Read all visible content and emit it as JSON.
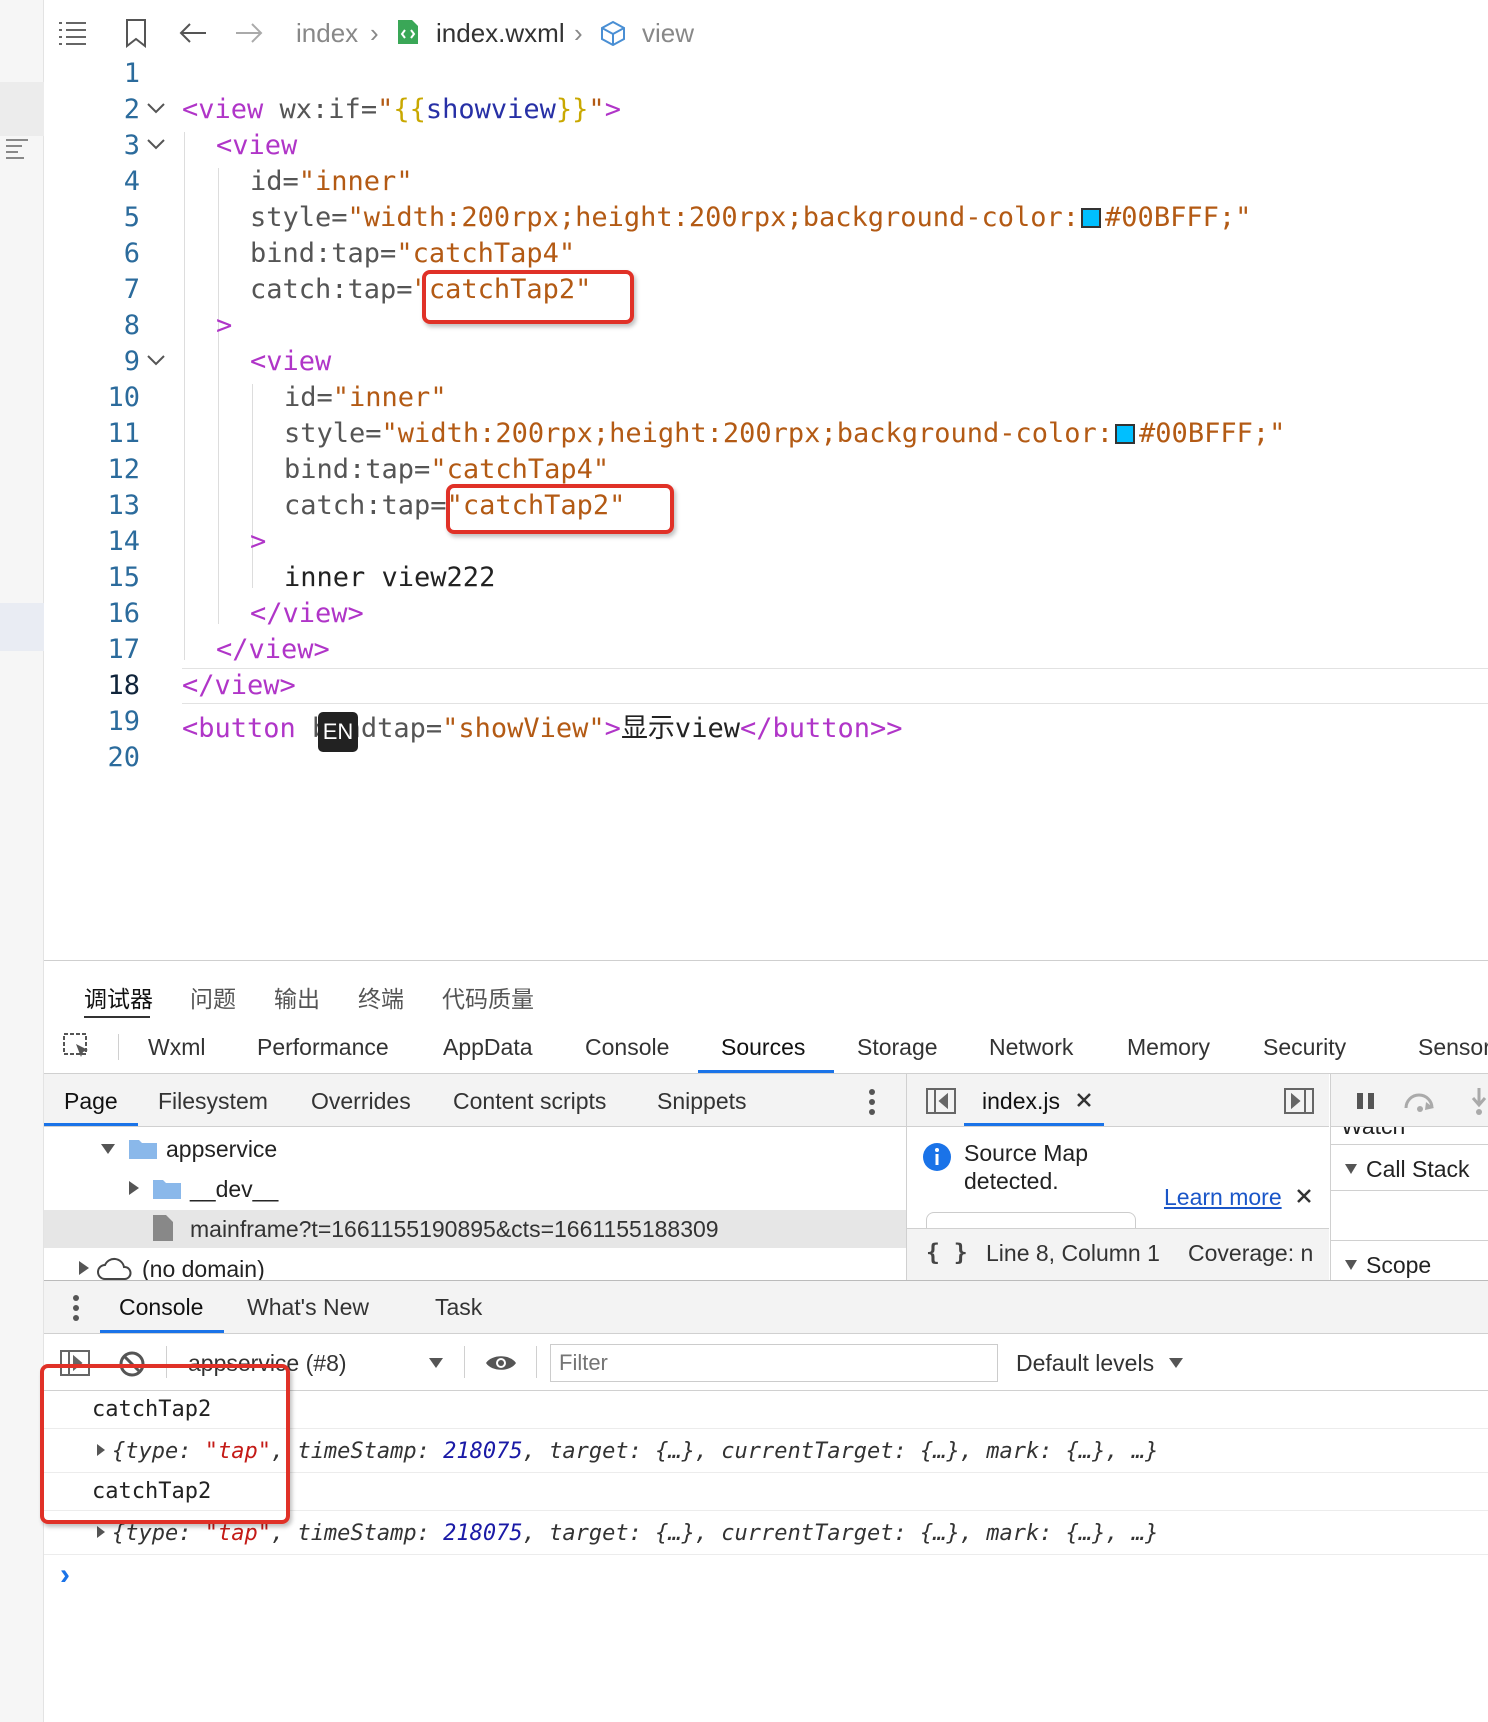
{
  "breadcrumb": {
    "items": [
      "index",
      "index.wxml",
      "view"
    ]
  },
  "editor": {
    "line_numbers": [
      "1",
      "2",
      "3",
      "4",
      "5",
      "6",
      "7",
      "8",
      "9",
      "10",
      "11",
      "12",
      "13",
      "14",
      "15",
      "16",
      "17",
      "18",
      "19",
      "20"
    ],
    "lines": {
      "l2_tag": "<view",
      "l2_attr": " wx:if=",
      "l2_q1": "\"",
      "l2_b1": "{{",
      "l2_var": "showview",
      "l2_b2": "}}",
      "l2_q2": "\"",
      "l2_end": ">",
      "l3_tag": "<view",
      "l4_attr": "id=",
      "l4_val": "\"inner\"",
      "l5_attr": "style=",
      "l5_val": "\"width:200rpx;height:200rpx;background-color:",
      "l5_color": "#00BFFF;\"",
      "l6_attr": "bind:tap=",
      "l6_val": "\"catchTap4\"",
      "l7_attr": "catch:tap=",
      "l7_val": "\"catchTap2\"",
      "l8": ">",
      "l9_tag": "<view",
      "l10_attr": "id=",
      "l10_val": "\"inner\"",
      "l11_attr": "style=",
      "l11_val": "\"width:200rpx;height:200rpx;background-color:",
      "l11_color": "#00BFFF;\"",
      "l12_attr": "bind:tap=",
      "l12_val": "\"catchTap4\"",
      "l13_attr": "catch:tap=",
      "l13_val": "\"catchTap2\"",
      "l14": ">",
      "l15": "inner view222",
      "l16": "</view>",
      "l17": "</view>",
      "l18": "</view>",
      "l19_tag": "<button",
      "l19_attr": " bindtap=",
      "l19_val": "\"showView\"",
      "l19_close": ">",
      "l19_text": "显示view",
      "l19_endtag": "</button>",
      "l19_endclose": ">"
    },
    "ime_badge": "EN",
    "swatch_color": "#00BFFF"
  },
  "panel_tabs": [
    "调试器",
    "问题",
    "输出",
    "终端",
    "代码质量"
  ],
  "devtools_tabs": [
    "Wxml",
    "Performance",
    "AppData",
    "Console",
    "Sources",
    "Storage",
    "Network",
    "Memory",
    "Security",
    "Sensor"
  ],
  "sources": {
    "nav_tabs": [
      "Page",
      "Filesystem",
      "Overrides",
      "Content scripts",
      "Snippets"
    ],
    "tree": {
      "appservice": "appservice",
      "dev": "__dev__",
      "mainframe": "mainframe?t=1661155190895&cts=1661155188309",
      "nodomain": "(no domain)"
    },
    "file_tab": "index.js",
    "sourcemap": {
      "line1": "Source Map",
      "line2": "detected.",
      "learn_more": "Learn more"
    },
    "status": {
      "braces": "{ }",
      "position": "Line 8, Column 1",
      "coverage": "Coverage: n"
    },
    "right": {
      "watch": "Watch",
      "call_stack": "Call Stack",
      "scope": "Scope"
    }
  },
  "drawer": {
    "tabs": [
      "Console",
      "What's New",
      "Task"
    ],
    "context": "appservice (#8)",
    "filter_placeholder": "Filter",
    "levels": "Default levels"
  },
  "console": {
    "log1": "catchTap2",
    "obj1": {
      "open": "{type: ",
      "type": "\"tap\"",
      "ts_key": ", timeStamp: ",
      "ts": "218075",
      "rest": ", target: {…}, currentTarget: {…}, mark: {…}, …}"
    },
    "log2": "catchTap2",
    "obj2": {
      "open": "{type: ",
      "type": "\"tap\"",
      "ts_key": ", timeStamp: ",
      "ts": "218075",
      "rest": ", target: {…}, currentTarget: {…}, mark: {…}, …}"
    },
    "prompt": "›"
  },
  "colors": {
    "accent": "#1a73e8",
    "highlight_box": "#e03127",
    "swatch": "#00BFFF"
  }
}
